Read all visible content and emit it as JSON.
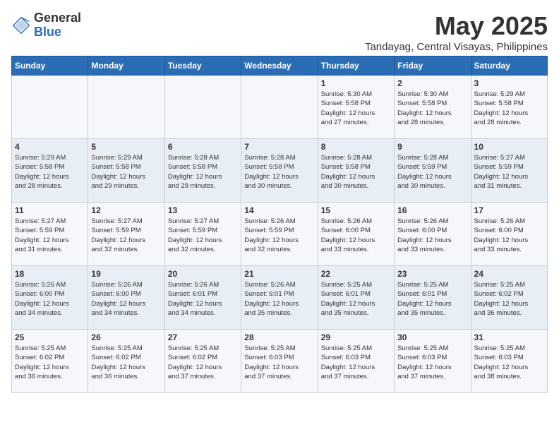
{
  "logo": {
    "general": "General",
    "blue": "Blue"
  },
  "title": "May 2025",
  "location": "Tandayag, Central Visayas, Philippines",
  "days_of_week": [
    "Sunday",
    "Monday",
    "Tuesday",
    "Wednesday",
    "Thursday",
    "Friday",
    "Saturday"
  ],
  "weeks": [
    [
      {
        "day": "",
        "info": ""
      },
      {
        "day": "",
        "info": ""
      },
      {
        "day": "",
        "info": ""
      },
      {
        "day": "",
        "info": ""
      },
      {
        "day": "1",
        "info": "Sunrise: 5:30 AM\nSunset: 5:58 PM\nDaylight: 12 hours\nand 27 minutes."
      },
      {
        "day": "2",
        "info": "Sunrise: 5:30 AM\nSunset: 5:58 PM\nDaylight: 12 hours\nand 28 minutes."
      },
      {
        "day": "3",
        "info": "Sunrise: 5:29 AM\nSunset: 5:58 PM\nDaylight: 12 hours\nand 28 minutes."
      }
    ],
    [
      {
        "day": "4",
        "info": "Sunrise: 5:29 AM\nSunset: 5:58 PM\nDaylight: 12 hours\nand 28 minutes."
      },
      {
        "day": "5",
        "info": "Sunrise: 5:29 AM\nSunset: 5:58 PM\nDaylight: 12 hours\nand 29 minutes."
      },
      {
        "day": "6",
        "info": "Sunrise: 5:28 AM\nSunset: 5:58 PM\nDaylight: 12 hours\nand 29 minutes."
      },
      {
        "day": "7",
        "info": "Sunrise: 5:28 AM\nSunset: 5:58 PM\nDaylight: 12 hours\nand 30 minutes."
      },
      {
        "day": "8",
        "info": "Sunrise: 5:28 AM\nSunset: 5:58 PM\nDaylight: 12 hours\nand 30 minutes."
      },
      {
        "day": "9",
        "info": "Sunrise: 5:28 AM\nSunset: 5:59 PM\nDaylight: 12 hours\nand 30 minutes."
      },
      {
        "day": "10",
        "info": "Sunrise: 5:27 AM\nSunset: 5:59 PM\nDaylight: 12 hours\nand 31 minutes."
      }
    ],
    [
      {
        "day": "11",
        "info": "Sunrise: 5:27 AM\nSunset: 5:59 PM\nDaylight: 12 hours\nand 31 minutes."
      },
      {
        "day": "12",
        "info": "Sunrise: 5:27 AM\nSunset: 5:59 PM\nDaylight: 12 hours\nand 32 minutes."
      },
      {
        "day": "13",
        "info": "Sunrise: 5:27 AM\nSunset: 5:59 PM\nDaylight: 12 hours\nand 32 minutes."
      },
      {
        "day": "14",
        "info": "Sunrise: 5:26 AM\nSunset: 5:59 PM\nDaylight: 12 hours\nand 32 minutes."
      },
      {
        "day": "15",
        "info": "Sunrise: 5:26 AM\nSunset: 6:00 PM\nDaylight: 12 hours\nand 33 minutes."
      },
      {
        "day": "16",
        "info": "Sunrise: 5:26 AM\nSunset: 6:00 PM\nDaylight: 12 hours\nand 33 minutes."
      },
      {
        "day": "17",
        "info": "Sunrise: 5:26 AM\nSunset: 6:00 PM\nDaylight: 12 hours\nand 33 minutes."
      }
    ],
    [
      {
        "day": "18",
        "info": "Sunrise: 5:26 AM\nSunset: 6:00 PM\nDaylight: 12 hours\nand 34 minutes."
      },
      {
        "day": "19",
        "info": "Sunrise: 5:26 AM\nSunset: 6:00 PM\nDaylight: 12 hours\nand 34 minutes."
      },
      {
        "day": "20",
        "info": "Sunrise: 5:26 AM\nSunset: 6:01 PM\nDaylight: 12 hours\nand 34 minutes."
      },
      {
        "day": "21",
        "info": "Sunrise: 5:26 AM\nSunset: 6:01 PM\nDaylight: 12 hours\nand 35 minutes."
      },
      {
        "day": "22",
        "info": "Sunrise: 5:25 AM\nSunset: 6:01 PM\nDaylight: 12 hours\nand 35 minutes."
      },
      {
        "day": "23",
        "info": "Sunrise: 5:25 AM\nSunset: 6:01 PM\nDaylight: 12 hours\nand 35 minutes."
      },
      {
        "day": "24",
        "info": "Sunrise: 5:25 AM\nSunset: 6:02 PM\nDaylight: 12 hours\nand 36 minutes."
      }
    ],
    [
      {
        "day": "25",
        "info": "Sunrise: 5:25 AM\nSunset: 6:02 PM\nDaylight: 12 hours\nand 36 minutes."
      },
      {
        "day": "26",
        "info": "Sunrise: 5:25 AM\nSunset: 6:02 PM\nDaylight: 12 hours\nand 36 minutes."
      },
      {
        "day": "27",
        "info": "Sunrise: 5:25 AM\nSunset: 6:02 PM\nDaylight: 12 hours\nand 37 minutes."
      },
      {
        "day": "28",
        "info": "Sunrise: 5:25 AM\nSunset: 6:03 PM\nDaylight: 12 hours\nand 37 minutes."
      },
      {
        "day": "29",
        "info": "Sunrise: 5:25 AM\nSunset: 6:03 PM\nDaylight: 12 hours\nand 37 minutes."
      },
      {
        "day": "30",
        "info": "Sunrise: 5:25 AM\nSunset: 6:03 PM\nDaylight: 12 hours\nand 37 minutes."
      },
      {
        "day": "31",
        "info": "Sunrise: 5:25 AM\nSunset: 6:03 PM\nDaylight: 12 hours\nand 38 minutes."
      }
    ]
  ]
}
